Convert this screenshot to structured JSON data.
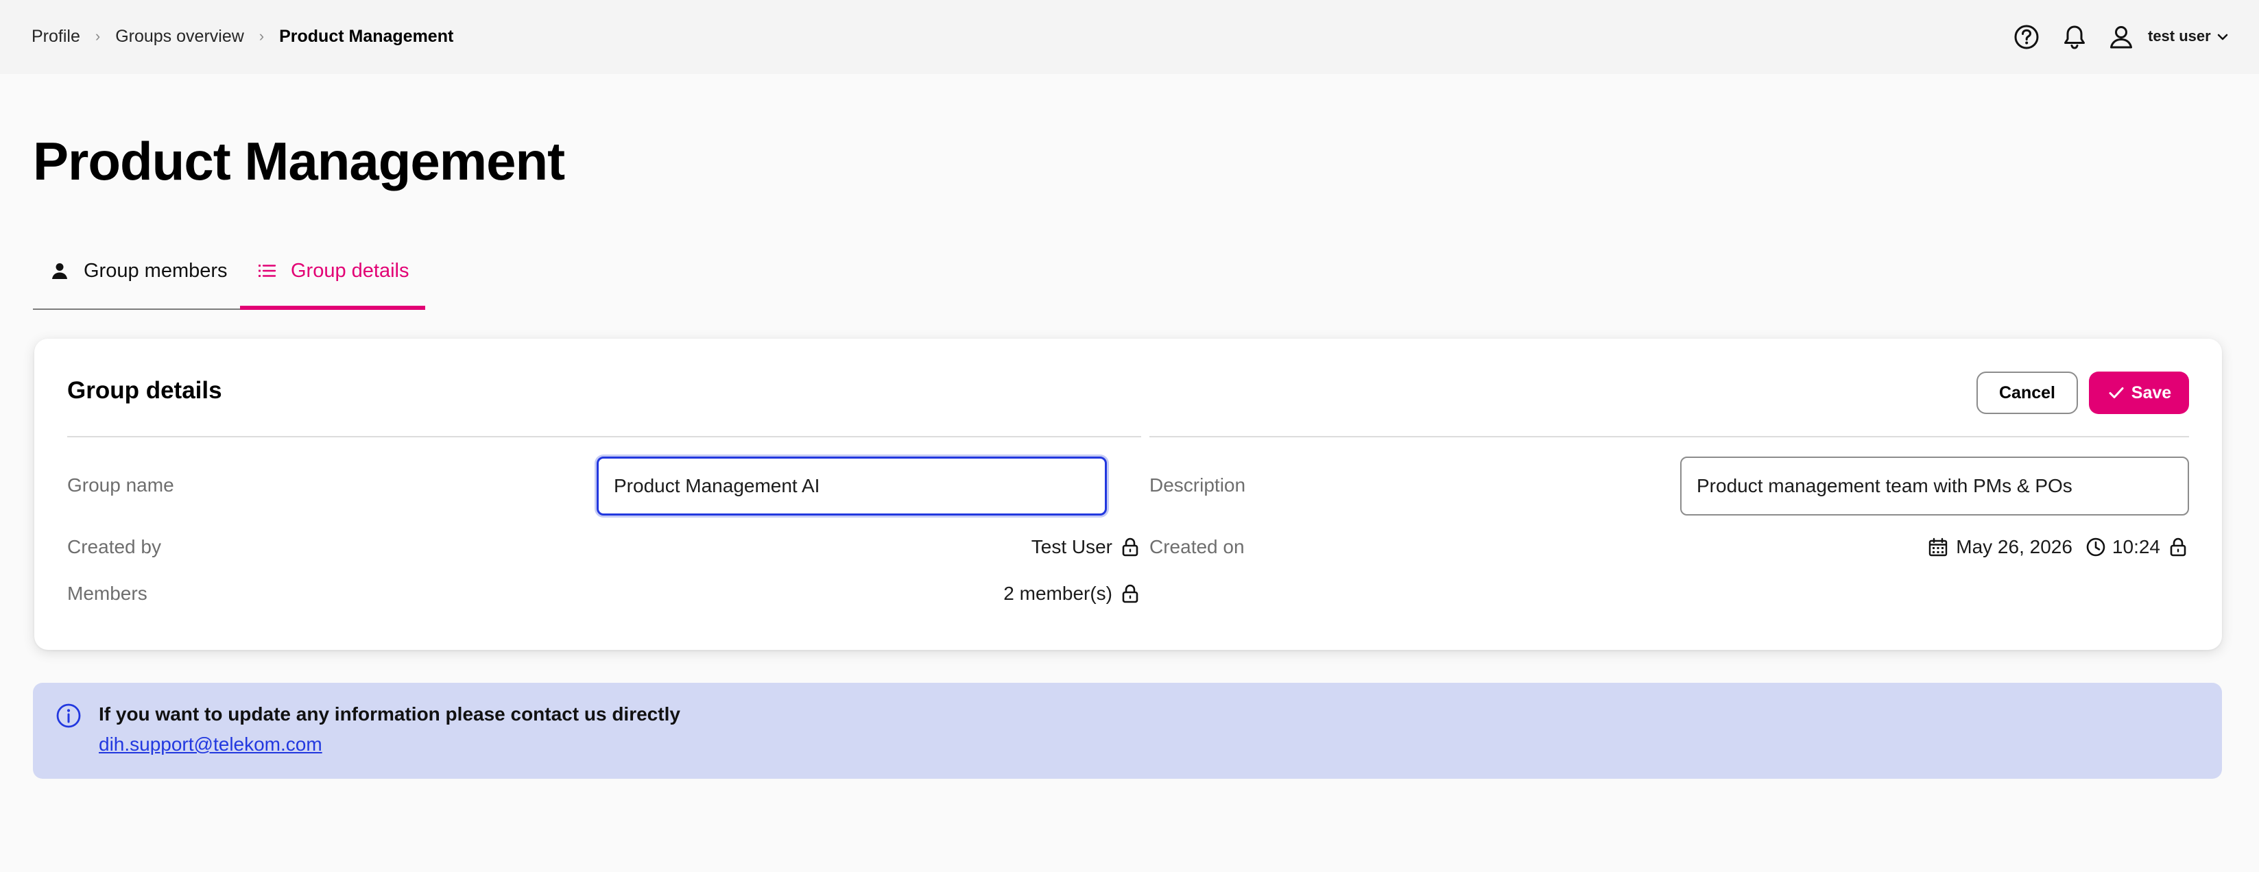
{
  "breadcrumb": {
    "items": [
      "Profile",
      "Groups overview",
      "Product Management"
    ],
    "separator": "›"
  },
  "header": {
    "user_name": "test user",
    "icons": [
      "help-icon",
      "bell-icon",
      "user-icon",
      "chevron-down-icon"
    ]
  },
  "page": {
    "title": "Product Management"
  },
  "tabs": [
    {
      "label": "Group members",
      "icon": "person-icon",
      "active": false
    },
    {
      "label": "Group details",
      "icon": "list-icon",
      "active": true
    }
  ],
  "card": {
    "title": "Group details",
    "cancel_label": "Cancel",
    "save_label": "Save",
    "fields": {
      "group_name": {
        "label": "Group name",
        "value": "Product Management AI"
      },
      "description": {
        "label": "Description",
        "value": "Product management team with PMs & POs"
      },
      "created_by": {
        "label": "Created by",
        "value": "Test User"
      },
      "created_on": {
        "label": "Created on",
        "date": "May 26, 2026",
        "time": "10:24"
      },
      "members": {
        "label": "Members",
        "value": "2 member(s)"
      }
    }
  },
  "info": {
    "message": "If you want to update any information please contact us directly",
    "email": "dih.support@telekom.com"
  },
  "colors": {
    "brand_magenta": "#e20074",
    "focus_blue": "#2238df",
    "info_background": "#d2d8f4",
    "page_background": "#fafafa",
    "header_background": "#f4f4f4"
  }
}
